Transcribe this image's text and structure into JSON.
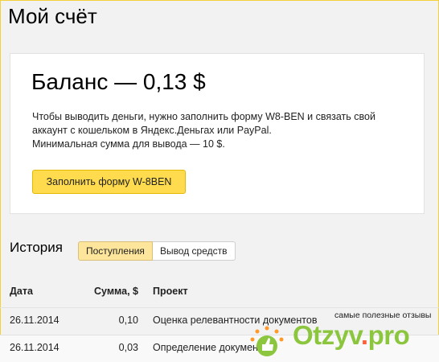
{
  "page": {
    "title": "Мой счёт"
  },
  "balance": {
    "heading": "Баланс — 0,13 $",
    "lines": [
      "Чтобы выводить деньги, нужно заполнить форму W8-BEN и связать свой",
      "аккаунт с кошельком в Яндекс.Деньгах или PayPal.",
      "Минимальная сумма для вывода — 10 $."
    ],
    "button_label": "Заполнить форму W-8BEN"
  },
  "history": {
    "title": "История",
    "tabs": [
      {
        "label": "Поступления",
        "active": true
      },
      {
        "label": "Вывод средств",
        "active": false
      }
    ],
    "columns": {
      "date": "Дата",
      "sum": "Сумма, $",
      "project": "Проект"
    },
    "rows": [
      {
        "date": "26.11.2014",
        "sum": "0,10",
        "project": "Оценка релевантности документов"
      },
      {
        "date": "26.11.2014",
        "sum": "0,03",
        "project": "Определение документов"
      }
    ]
  },
  "watermark": {
    "tagline": "самые полезные отзывы",
    "logo_main": "Otzyv",
    "logo_dot": ".",
    "logo_tld": "pro"
  },
  "colors": {
    "accent": "#ffdb4d",
    "tab_active": "#fde69b",
    "logo_green": "#8cc63f",
    "logo_dot": "#ff5e3a"
  }
}
